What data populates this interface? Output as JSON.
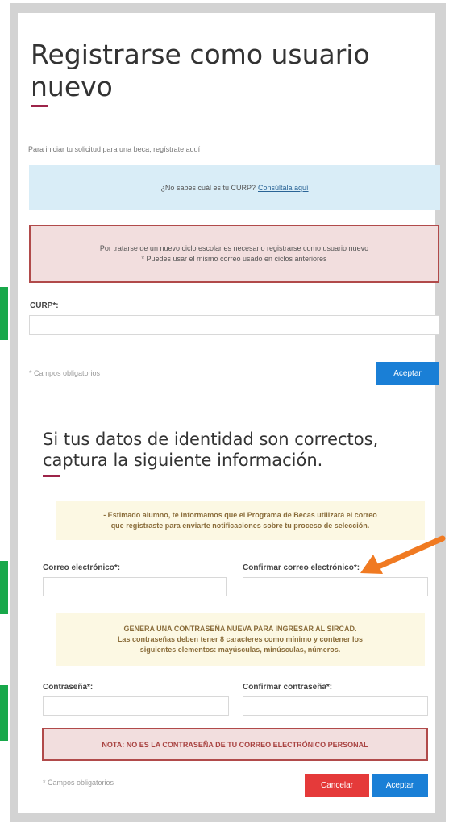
{
  "page": {
    "title": "Registrarse como usuario nuevo",
    "intro": "Para iniciar tu solicitud para una beca, regístrate aquí",
    "curp_info": {
      "text": "¿No sabes cuál es tu CURP?",
      "link": "Consúltala aquí"
    },
    "cycle_notice": {
      "line1": "Por tratarse de un nuevo ciclo escolar es necesario registrarse como usuario nuevo",
      "line2": "* Puedes usar el mismo correo usado en ciclos anteriores"
    },
    "curp_label": "CURP*:",
    "curp_value": "",
    "required_hint": "* Campos obligatorios",
    "accept_label": "Aceptar"
  },
  "identity": {
    "title": "Si tus datos de identidad son correctos, captura la siguiente información.",
    "email_notice": {
      "line1": "- Estimado alumno, te informamos que el Programa de Becas utilizará el correo",
      "line2": "que registraste para enviarte notificaciones sobre tu proceso de selección."
    },
    "email_label": "Correo electrónico*:",
    "email_value": "",
    "confirm_email_label": "Confirmar correo electrónico*:",
    "confirm_email_value": "",
    "password_notice": {
      "line1": "GENERA UNA CONTRASEÑA NUEVA PARA INGRESAR AL SIRCAD.",
      "line2": "Las contraseñas deben tener 8 caracteres como mínimo y contener los",
      "line3": "siguientes elementos: mayúsculas, minúsculas, números."
    },
    "password_label": "Contraseña*:",
    "password_value": "",
    "confirm_password_label": "Confirmar contraseña*:",
    "confirm_password_value": "",
    "note": "NOTA: NO ES LA CONTRASEÑA DE TU CORREO ELECTRÓNICO PERSONAL",
    "required_hint": "* Campos obligatorios",
    "cancel_label": "Cancelar",
    "accept_label": "Aceptar"
  },
  "icons": {
    "pointer": "arrow-pointer-icon"
  },
  "colors": {
    "accent": "#9d2449",
    "primary_button": "#1a7fd6",
    "cancel_button": "#e53a3a",
    "info_bg": "#d9edf7",
    "danger_bg": "#f2dede",
    "warning_bg": "#fcf8e3",
    "marker": "#18a84a",
    "arrow": "#f07a22"
  }
}
